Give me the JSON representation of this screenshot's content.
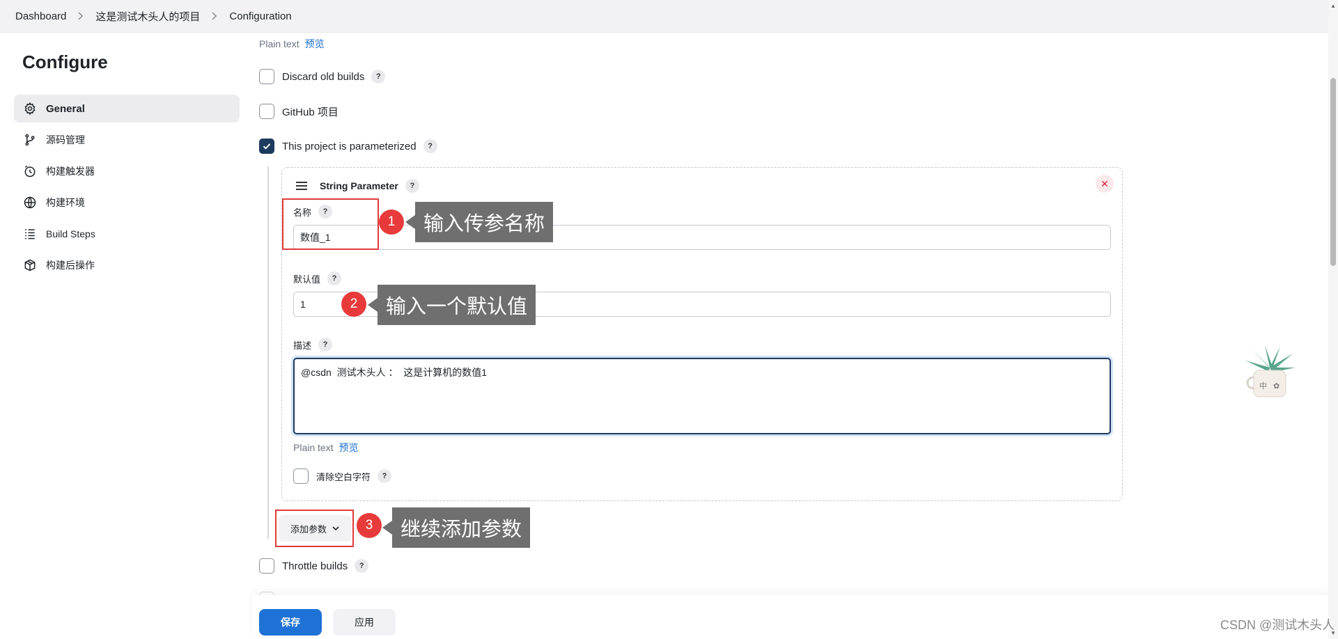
{
  "breadcrumb": {
    "items": [
      "Dashboard",
      "这是测试木头人的项目",
      "Configuration"
    ]
  },
  "sidebar": {
    "title": "Configure",
    "items": [
      {
        "label": "General",
        "icon": "gear-icon",
        "active": true
      },
      {
        "label": "源码管理",
        "icon": "git-branch-icon"
      },
      {
        "label": "构建触发器",
        "icon": "clock-icon"
      },
      {
        "label": "构建环境",
        "icon": "globe-icon"
      },
      {
        "label": "Build Steps",
        "icon": "list-icon"
      },
      {
        "label": "构建后操作",
        "icon": "package-icon"
      }
    ]
  },
  "main": {
    "top_hint": {
      "plain": "Plain text",
      "preview": "预览"
    },
    "options": {
      "discard_old_builds": {
        "label": "Discard old builds",
        "checked": false
      },
      "github_project": {
        "label": "GitHub 项目",
        "checked": false
      },
      "parameterized": {
        "label": "This project is parameterized",
        "checked": true
      },
      "throttle_builds": {
        "label": "Throttle builds",
        "checked": false
      }
    },
    "string_parameter": {
      "title": "String Parameter",
      "name_label": "名称",
      "name_value": "数值_1",
      "default_label": "默认值",
      "default_value": "1",
      "desc_label": "描述",
      "desc_value": "@csdn  测试木头人 ：  这是计算机的数值1",
      "desc_hint": {
        "plain": "Plain text",
        "preview": "预览"
      },
      "trim_label": "清除空白字符"
    },
    "add_param_label": "添加参数",
    "help_glyph": "?"
  },
  "footer": {
    "save_label": "保存",
    "apply_label": "应用"
  },
  "annotations": [
    {
      "number": "1",
      "text": "输入传参名称"
    },
    {
      "number": "2",
      "text": "输入一个默认值"
    },
    {
      "number": "3",
      "text": "继续添加参数"
    }
  ],
  "watermark": "CSDN @测试木头人",
  "plant_cup_text": "中",
  "colors": {
    "primary": "#1e72d6",
    "checked": "#1d3a5f",
    "annotation_red": "#e83a3a",
    "callout_bg": "#6f6f6f"
  }
}
